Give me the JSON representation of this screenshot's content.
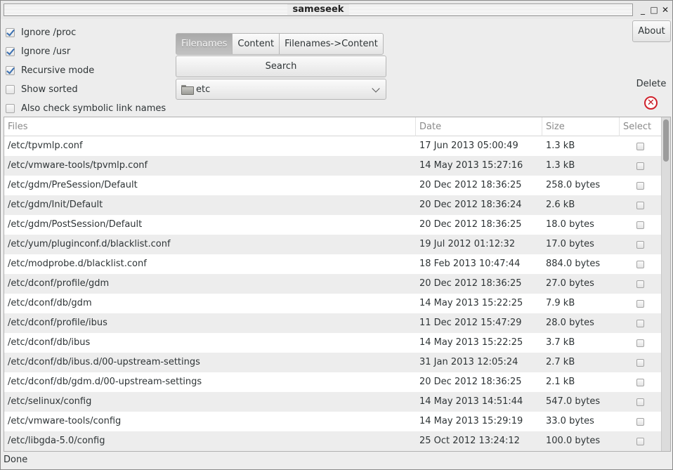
{
  "window": {
    "title": "sameseek"
  },
  "window_buttons": {
    "minimize": "_",
    "maximize": "□",
    "close": "✕"
  },
  "options": [
    {
      "label": "Ignore /proc",
      "checked": true
    },
    {
      "label": "Ignore /usr",
      "checked": true
    },
    {
      "label": "Recursive mode",
      "checked": true
    },
    {
      "label": "Show sorted",
      "checked": false
    },
    {
      "label": "Also check symbolic link names",
      "checked": false
    }
  ],
  "tabs": [
    {
      "label": "Filenames",
      "active": true
    },
    {
      "label": "Content",
      "active": false
    },
    {
      "label": "Filenames->Content",
      "active": false
    }
  ],
  "search": {
    "label": "Search"
  },
  "folder_combo": {
    "value": "etc",
    "icon": "folder-icon"
  },
  "about": {
    "label": "About"
  },
  "delete": {
    "label": "Delete",
    "icon": "delete-icon"
  },
  "table": {
    "headers": {
      "files": "Files",
      "date": "Date",
      "size": "Size",
      "select": "Select"
    },
    "rows": [
      {
        "file": "/etc/tpvmlp.conf",
        "date": "17 Jun 2013 05:00:49",
        "size": "1.3 kB"
      },
      {
        "file": "/etc/vmware-tools/tpvmlp.conf",
        "date": "14 May 2013 15:27:16",
        "size": "1.3 kB"
      },
      {
        "file": "/etc/gdm/PreSession/Default",
        "date": "20 Dec 2012 18:36:25",
        "size": "258.0 bytes"
      },
      {
        "file": "/etc/gdm/Init/Default",
        "date": "20 Dec 2012 18:36:24",
        "size": "2.6 kB"
      },
      {
        "file": "/etc/gdm/PostSession/Default",
        "date": "20 Dec 2012 18:36:25",
        "size": "18.0 bytes"
      },
      {
        "file": "/etc/yum/pluginconf.d/blacklist.conf",
        "date": "19 Jul 2012 01:12:32",
        "size": "17.0 bytes"
      },
      {
        "file": "/etc/modprobe.d/blacklist.conf",
        "date": "18 Feb 2013 10:47:44",
        "size": "884.0 bytes"
      },
      {
        "file": "/etc/dconf/profile/gdm",
        "date": "20 Dec 2012 18:36:25",
        "size": "27.0 bytes"
      },
      {
        "file": "/etc/dconf/db/gdm",
        "date": "14 May 2013 15:22:25",
        "size": "7.9 kB"
      },
      {
        "file": "/etc/dconf/profile/ibus",
        "date": "11 Dec 2012 15:47:29",
        "size": "28.0 bytes"
      },
      {
        "file": "/etc/dconf/db/ibus",
        "date": "14 May 2013 15:22:25",
        "size": "3.7 kB"
      },
      {
        "file": "/etc/dconf/db/ibus.d/00-upstream-settings",
        "date": "31 Jan 2013 12:05:24",
        "size": "2.7 kB"
      },
      {
        "file": "/etc/dconf/db/gdm.d/00-upstream-settings",
        "date": "20 Dec 2012 18:36:25",
        "size": "2.1 kB"
      },
      {
        "file": "/etc/selinux/config",
        "date": "14 May 2013 14:51:44",
        "size": "547.0 bytes"
      },
      {
        "file": "/etc/vmware-tools/config",
        "date": "14 May 2013 15:29:19",
        "size": "33.0 bytes"
      },
      {
        "file": "/etc/libgda-5.0/config",
        "date": "25 Oct 2012 13:24:12",
        "size": "100.0 bytes"
      }
    ]
  },
  "status": {
    "text": "Done"
  }
}
